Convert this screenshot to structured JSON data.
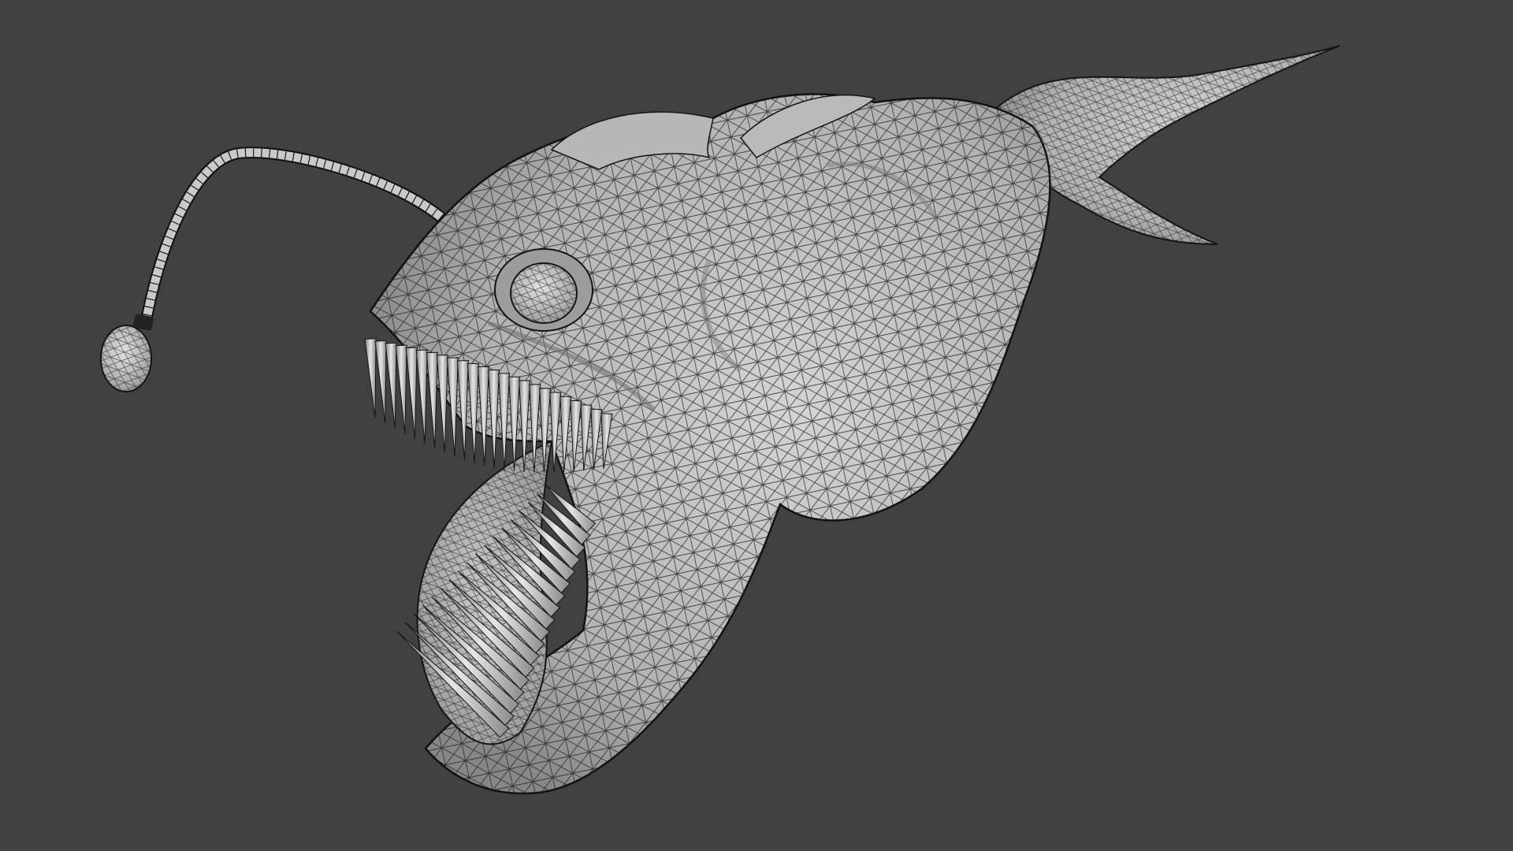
{
  "scene": {
    "background_color": "#414141",
    "mesh_fill_color": "#bdbdbd",
    "mesh_shade_color": "#8a8a8a",
    "wire_color": "#1a1a1a",
    "subject": "anglerfish-wireframe-mesh",
    "display_mode": "wireframe-on-shaded"
  }
}
